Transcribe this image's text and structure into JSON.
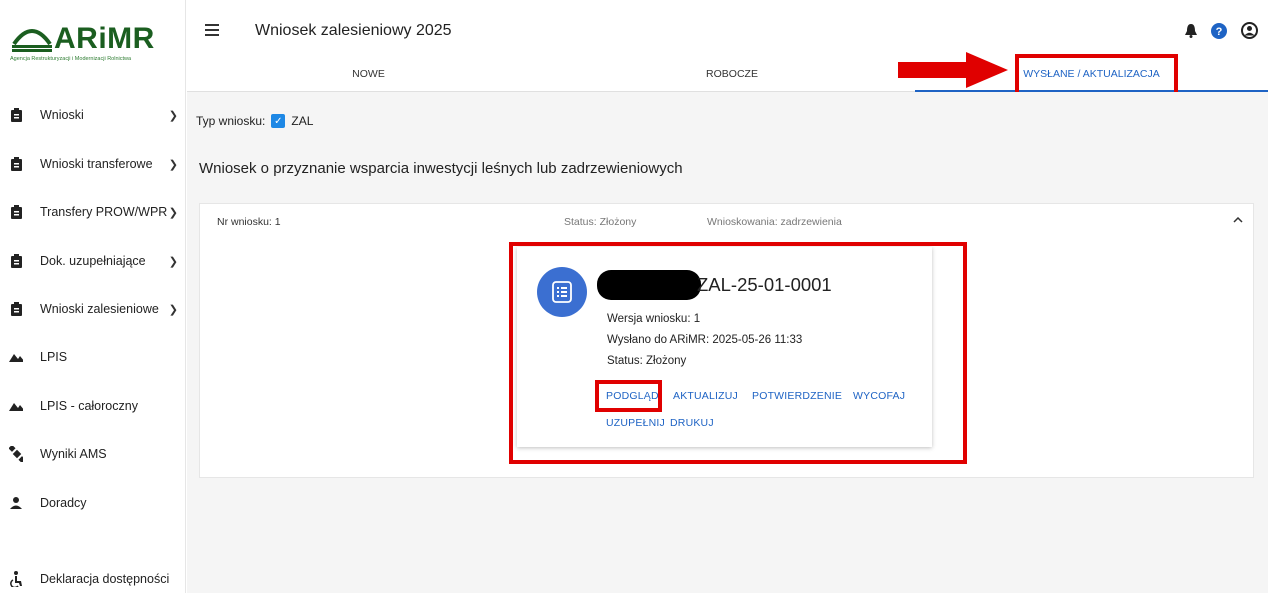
{
  "logo": {
    "text": "ARiMR",
    "subtitle": "Agencja Restrukturyzacji i Modernizacji Rolnictwa"
  },
  "sidebar": {
    "items": [
      {
        "label": "Wnioski",
        "icon": "clipboard-icon",
        "chevron": true
      },
      {
        "label": "Wnioski transferowe",
        "icon": "clipboard-icon",
        "chevron": true
      },
      {
        "label": "Transfery PROW/WPR",
        "icon": "clipboard-icon",
        "chevron": true
      },
      {
        "label": "Dok. uzupełniające",
        "icon": "clipboard-icon",
        "chevron": true
      },
      {
        "label": "Wnioski zalesieniowe",
        "icon": "clipboard-icon",
        "chevron": true
      },
      {
        "label": "LPIS",
        "icon": "terrain-icon",
        "chevron": false
      },
      {
        "label": "LPIS - całoroczny",
        "icon": "terrain-icon",
        "chevron": false
      },
      {
        "label": "Wyniki AMS",
        "icon": "satellite-icon",
        "chevron": false
      },
      {
        "label": "Doradcy",
        "icon": "person-icon",
        "chevron": false
      },
      {
        "label": "Deklaracja dostępności",
        "icon": "accessibility-icon",
        "chevron": false
      }
    ]
  },
  "header": {
    "title": "Wniosek zalesieniowy 2025"
  },
  "tabs": [
    {
      "label": "NOWE"
    },
    {
      "label": "ROBOCZE"
    },
    {
      "label": "WYSŁANE / AKTUALIZACJA"
    }
  ],
  "filter": {
    "label": "Typ wniosku:",
    "value": "ZAL"
  },
  "section": {
    "title": "Wniosek o przyznanie wsparcia inwestycji leśnych lub zadrzewieniowych"
  },
  "panel": {
    "number": "Nr wniosku: 1",
    "status": "Status: Złożony",
    "type": "Wnioskowania: zadrzewienia",
    "collapse_icon": "^"
  },
  "card": {
    "id": "ZAL-25-01-0001",
    "version": "Wersja wniosku: 1",
    "sent": "Wysłano do ARiMR: 2025-05-26 11:33",
    "status": "Status: Złożony",
    "buttons": [
      "PODGLĄD",
      "AKTUALIZUJ",
      "POTWIERDZENIE",
      "WYCOFAJ",
      "UZUPEŁNIJ",
      "DRUKUJ"
    ]
  },
  "colors": {
    "accent": "#1e63c4",
    "highlight": "#e00000",
    "brand": "#1b5e20"
  }
}
